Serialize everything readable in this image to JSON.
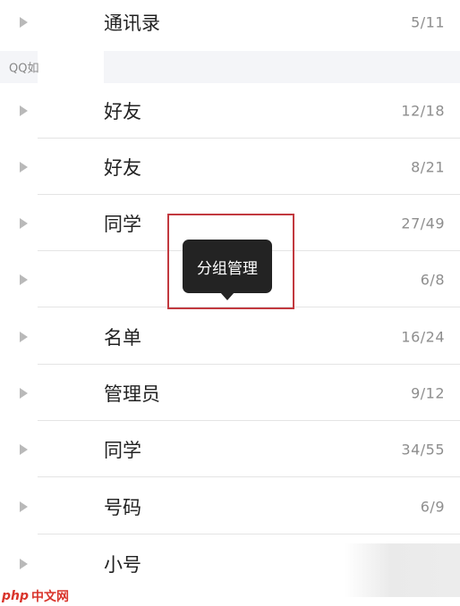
{
  "section": {
    "label": "QQ如"
  },
  "groups": [
    {
      "name": "通讯录",
      "count": "5/11"
    },
    {
      "name": "好友",
      "count": "12/18"
    },
    {
      "name": "好友",
      "count": "8/21"
    },
    {
      "name": "同学",
      "count": "27/49"
    },
    {
      "name": "",
      "count": "6/8"
    },
    {
      "name": "名单",
      "count": "16/24"
    },
    {
      "name": "管理员",
      "count": "9/12"
    },
    {
      "name": "同学",
      "count": "34/55"
    },
    {
      "name": "号码",
      "count": "6/9"
    },
    {
      "name": "小号",
      "count": ""
    }
  ],
  "tooltip": {
    "label": "分组管理"
  },
  "watermark": {
    "logo": "php",
    "text": "中文网"
  },
  "colors": {
    "highlight": "#c2393f",
    "tooltip_bg": "#232323",
    "watermark": "#d9342b"
  }
}
